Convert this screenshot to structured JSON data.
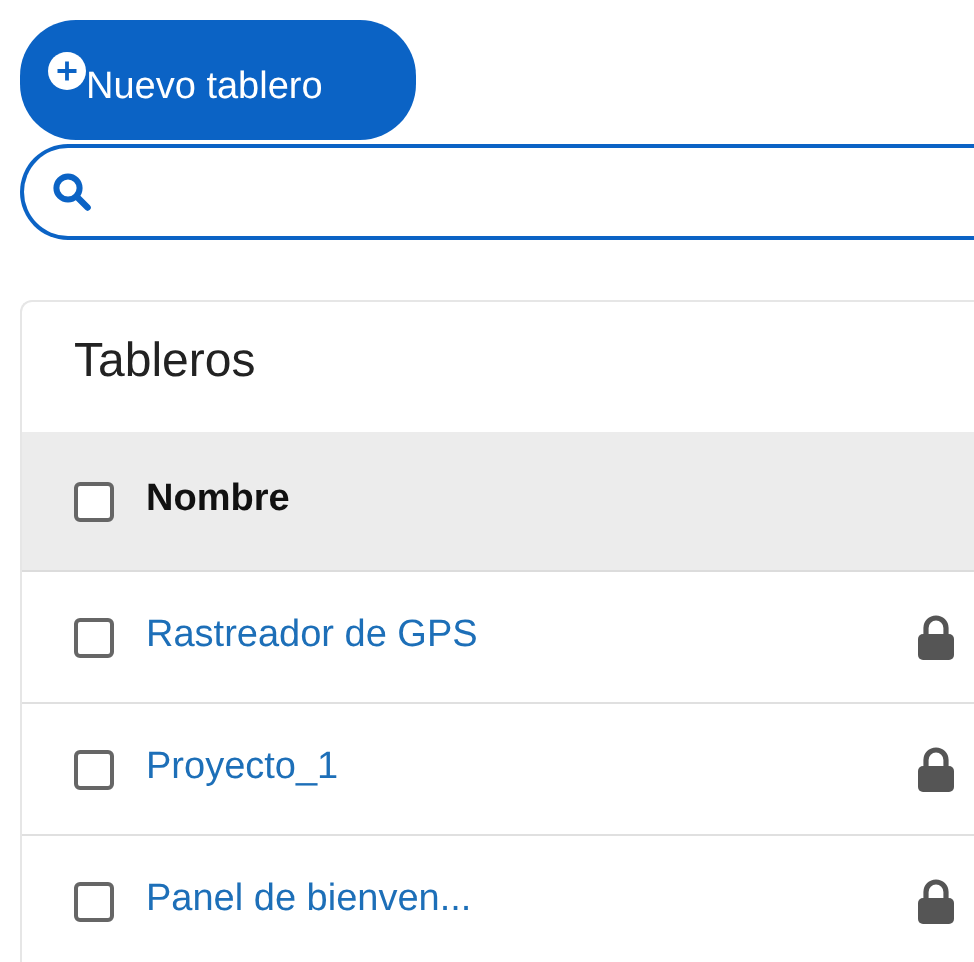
{
  "new_board_button": {
    "label": "Nuevo tablero"
  },
  "boards": {
    "title": "Tableros",
    "header": {
      "label": "Nombre",
      "checked": false
    },
    "rows": [
      {
        "name": "Rastreador de GPS",
        "checked": false,
        "locked": true
      },
      {
        "name": "Proyecto_1",
        "checked": false,
        "locked": true
      },
      {
        "name": "Panel de bienven...",
        "checked": false,
        "locked": true
      }
    ]
  }
}
